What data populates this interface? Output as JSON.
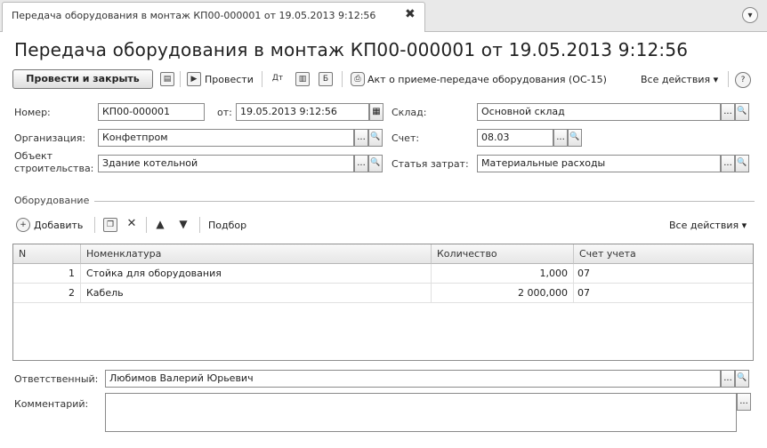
{
  "tab": {
    "title": "Передача оборудования в монтаж КП00-000001 от 19.05.2013 9:12:56",
    "close": "✖"
  },
  "form": {
    "title": "Передача оборудования в монтаж КП00-000001 от 19.05.2013 9:12:56"
  },
  "toolbar": {
    "post_close": "Провести и закрыть",
    "post": "Провести",
    "act": "Акт о приеме-передаче оборудования (ОС-15)",
    "all_actions": "Все действия ▾",
    "help": "?"
  },
  "fields": {
    "number_label": "Номер:",
    "number_value": "КП00-000001",
    "date_label": "от:",
    "date_value": "19.05.2013  9:12:56",
    "org_label": "Организация:",
    "org_value": "Конфетпром",
    "object_label_1": "Объект",
    "object_label_2": "строительства:",
    "object_value": "Здание котельной",
    "warehouse_label": "Склад:",
    "warehouse_value": "Основной склад",
    "account_label": "Счет:",
    "account_value": "08.03",
    "cost_label": "Статья затрат:",
    "cost_value": "Материальные расходы",
    "responsible_label": "Ответственный:",
    "responsible_value": "Любимов Валерий Юрьевич",
    "comment_label": "Комментарий:",
    "comment_value": ""
  },
  "equipment": {
    "section_label": "Оборудование",
    "add": "Добавить",
    "pick": "Подбор",
    "all_actions": "Все действия ▾",
    "columns": [
      "N",
      "Номенклатура",
      "Количество",
      "Счет учета"
    ],
    "rows": [
      {
        "n": "1",
        "name": "Стойка для оборудования",
        "qty": "1,000",
        "account": "07"
      },
      {
        "n": "2",
        "name": "Кабель",
        "qty": "2 000,000",
        "account": "07"
      }
    ]
  },
  "icons": {
    "dots": "...",
    "search": "🔍",
    "calendar": "▦"
  }
}
